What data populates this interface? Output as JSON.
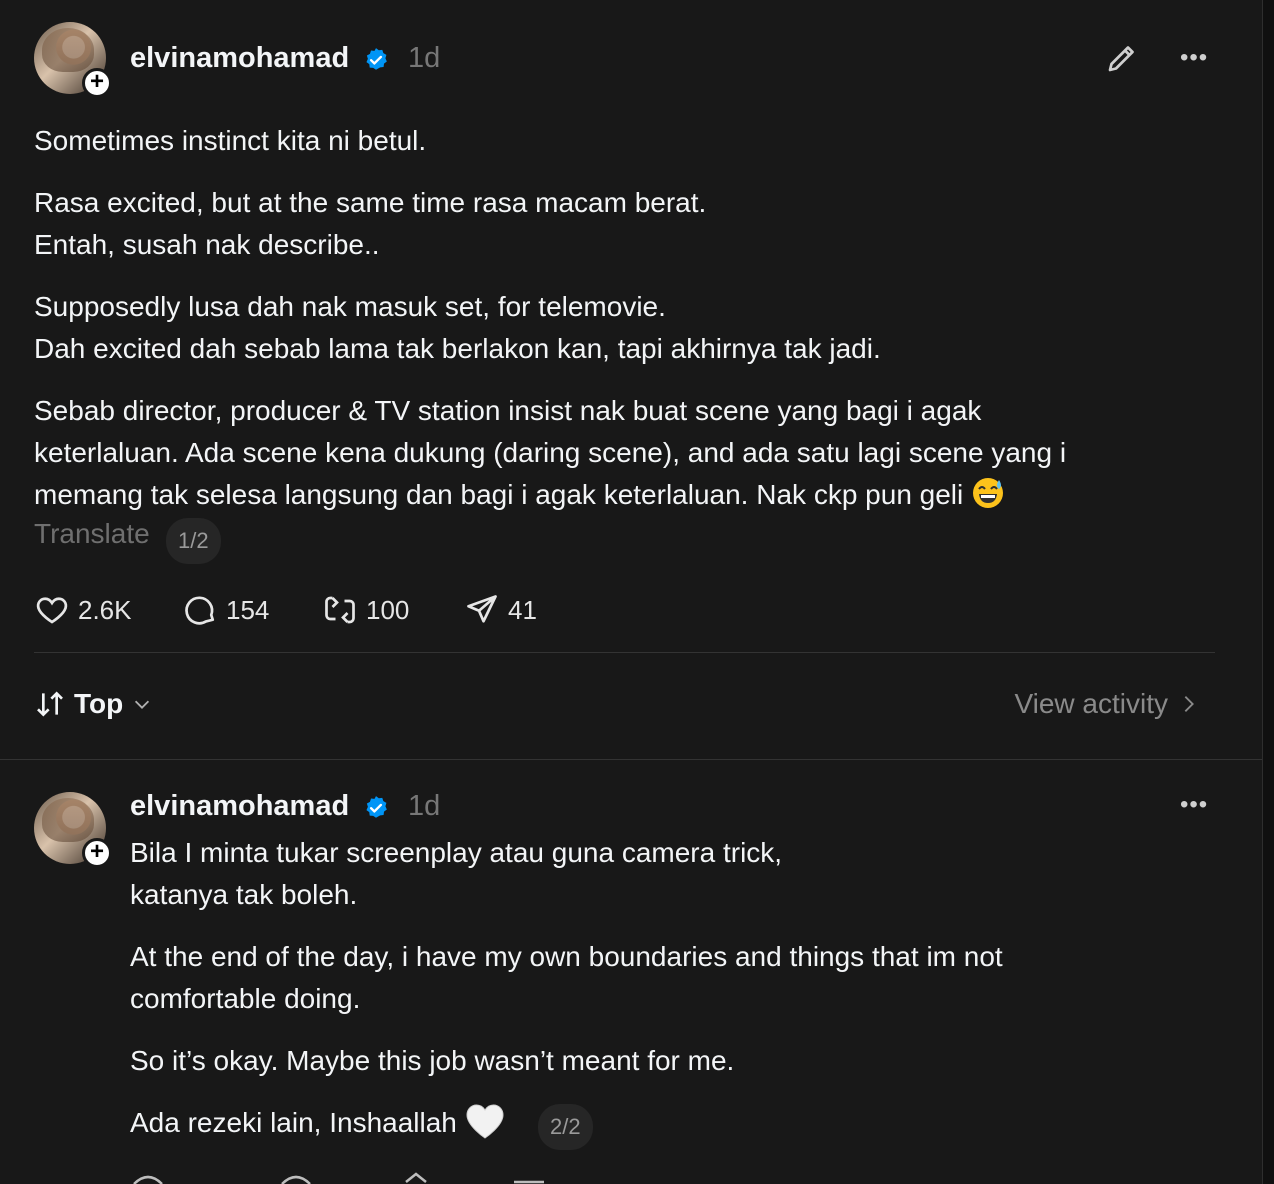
{
  "post": {
    "username": "elvinamohamad",
    "time": "1d",
    "paragraphs": [
      "Sometimes instinct kita ni betul.",
      "Rasa excited, but at the same time rasa macam berat.\nEntah, susah nak describe..",
      "Supposedly lusa dah nak masuk set, for telemovie.\nDah excited dah sebab lama tak berlakon kan, tapi akhirnya tak jadi.",
      "Sebab director, producer & TV station insist nak buat scene yang bagi i agak\nketerlaluan. Ada scene kena dukung (daring scene), and ada satu lagi scene yang i\nmemang tak selesa langsung dan bagi i agak keterlaluan. Nak ckp pun geli"
    ],
    "translate_label": "Translate",
    "page_indicator": "1/2",
    "likes": "2.6K",
    "comments": "154",
    "reposts": "100",
    "shares": "41"
  },
  "sort": {
    "label": "Top"
  },
  "view_activity": "View activity",
  "reply": {
    "username": "elvinamohamad",
    "time": "1d",
    "paragraphs": [
      "Bila I minta tukar screenplay atau guna camera trick,\nkatanya tak boleh.",
      "At the end of the day, i have my own boundaries and things that im not\ncomfortable doing.",
      "So it’s okay. Maybe this job wasn’t meant for me.",
      "Ada rezeki lain, Inshaallah"
    ],
    "page_indicator": "2/2"
  },
  "colors": {
    "background": "#181818",
    "verified": "#0095f6",
    "muted": "#777777"
  },
  "icons": [
    "pencil-icon",
    "more-icon",
    "heart-icon",
    "comment-icon",
    "repost-icon",
    "share-icon",
    "sort-icon",
    "chevron-down-icon",
    "chevron-right-icon",
    "verified-icon",
    "plus-icon"
  ]
}
